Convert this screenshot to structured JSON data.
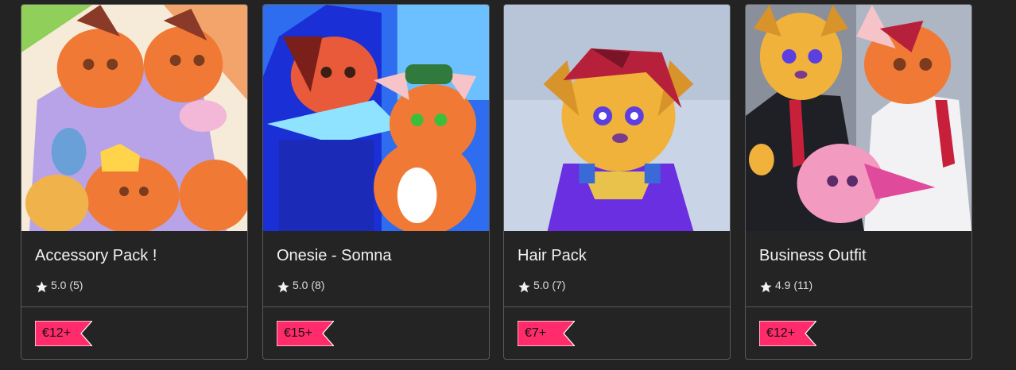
{
  "products": [
    {
      "title": "Accessory Pack !",
      "rating": "5.0",
      "reviews": "(5)",
      "price": "€12+",
      "image": "fox-avatars-accessory-art"
    },
    {
      "title": "Onesie - Somna",
      "rating": "5.0",
      "reviews": "(8)",
      "price": "€15+",
      "image": "fox-onesie-art"
    },
    {
      "title": "Hair Pack",
      "rating": "5.0",
      "reviews": "(7)",
      "price": "€7+",
      "image": "dog-avatar-hair-art"
    },
    {
      "title": "Business Outfit",
      "rating": "4.9",
      "reviews": "(11)",
      "price": "€12+",
      "image": "business-outfit-art"
    }
  ],
  "colors": {
    "background": "#232323",
    "card_border": "#5a5a5a",
    "price_tag": "#ff2b6a",
    "title_text": "#f2f2f2",
    "rating_text": "#dcdcdc"
  },
  "icons": {
    "rating": "star-icon",
    "price": "price-tag-icon"
  }
}
